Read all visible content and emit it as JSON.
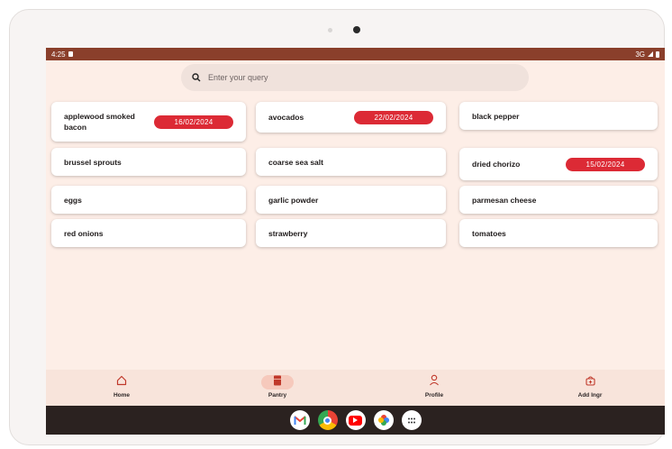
{
  "status": {
    "time": "4:25",
    "network": "3G"
  },
  "search": {
    "placeholder": "Enter your query"
  },
  "ingredients": [
    {
      "name": "applewood smoked bacon",
      "date": "16/02/2024"
    },
    {
      "name": "avocados",
      "date": "22/02/2024"
    },
    {
      "name": "black pepper",
      "date": ""
    },
    {
      "name": "brussel sprouts",
      "date": ""
    },
    {
      "name": "coarse sea salt",
      "date": ""
    },
    {
      "name": "dried chorizo",
      "date": "15/02/2024"
    },
    {
      "name": "eggs",
      "date": ""
    },
    {
      "name": "garlic powder",
      "date": ""
    },
    {
      "name": "parmesan cheese",
      "date": ""
    },
    {
      "name": "red onions",
      "date": ""
    },
    {
      "name": "strawberry",
      "date": ""
    },
    {
      "name": "tomatoes",
      "date": ""
    }
  ],
  "nav": [
    {
      "label": "Home",
      "icon": "home-icon",
      "active": false
    },
    {
      "label": "Pantry",
      "icon": "pantry-icon",
      "active": true
    },
    {
      "label": "Profile",
      "icon": "profile-icon",
      "active": false
    },
    {
      "label": "Add Ingr",
      "icon": "add-ingredient-icon",
      "active": false
    }
  ],
  "taskbar": [
    "gmail-icon",
    "chrome-icon",
    "youtube-icon",
    "photos-icon",
    "app-drawer-icon"
  ],
  "colors": {
    "accent": "#dc2a35",
    "statusbar": "#8a3f2b",
    "background": "#fdeee7",
    "nav_active": "#f6c9bc"
  }
}
